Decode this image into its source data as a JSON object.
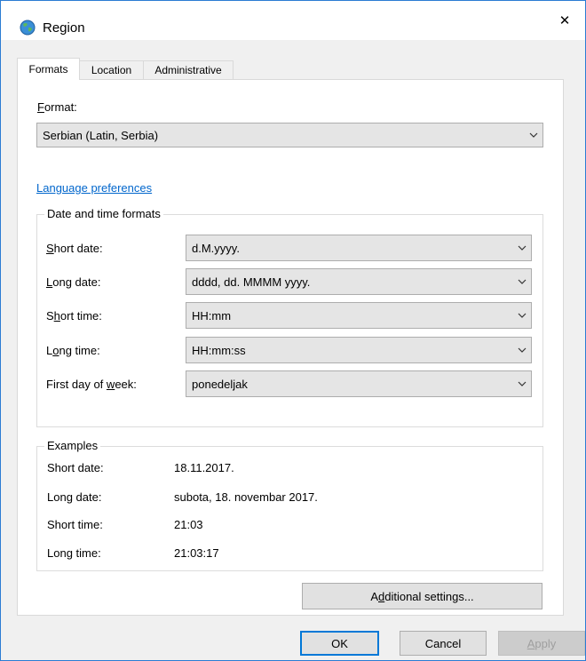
{
  "window": {
    "title": "Region",
    "close_symbol": "✕"
  },
  "tabs": [
    {
      "label": "Formats",
      "active": true
    },
    {
      "label": "Location",
      "active": false
    },
    {
      "label": "Administrative",
      "active": false
    }
  ],
  "format": {
    "label_prefix": "",
    "label_hotkey": "F",
    "label_rest": "ormat:",
    "value": "Serbian (Latin, Serbia)"
  },
  "language_preferences_link": "Language preferences",
  "date_time_formats": {
    "title": "Date and time formats",
    "fields": [
      {
        "pre": "",
        "hot": "S",
        "post": "hort date:",
        "value": "d.M.yyyy."
      },
      {
        "pre": "",
        "hot": "L",
        "post": "ong date:",
        "value": "dddd, dd. MMMM yyyy."
      },
      {
        "pre": "S",
        "hot": "h",
        "post": "ort time:",
        "value": "HH:mm"
      },
      {
        "pre": "L",
        "hot": "o",
        "post": "ng time:",
        "value": "HH:mm:ss"
      },
      {
        "pre": "First day of ",
        "hot": "w",
        "post": "eek:",
        "value": "ponedeljak"
      }
    ]
  },
  "examples": {
    "title": "Examples",
    "rows": [
      {
        "label": "Short date:",
        "value": "18.11.2017."
      },
      {
        "label": "Long date:",
        "value": "subota, 18. novembar 2017."
      },
      {
        "label": "Short time:",
        "value": "21:03"
      },
      {
        "label": "Long time:",
        "value": "21:03:17"
      }
    ]
  },
  "additional_settings": {
    "pre": "A",
    "hot": "d",
    "post": "ditional settings..."
  },
  "buttons": {
    "ok": "OK",
    "cancel": "Cancel",
    "apply_hot": "A",
    "apply_rest": "pply"
  },
  "colors": {
    "accent": "#0078d7",
    "link": "#0066cc",
    "window_border": "#2b7cd3"
  }
}
